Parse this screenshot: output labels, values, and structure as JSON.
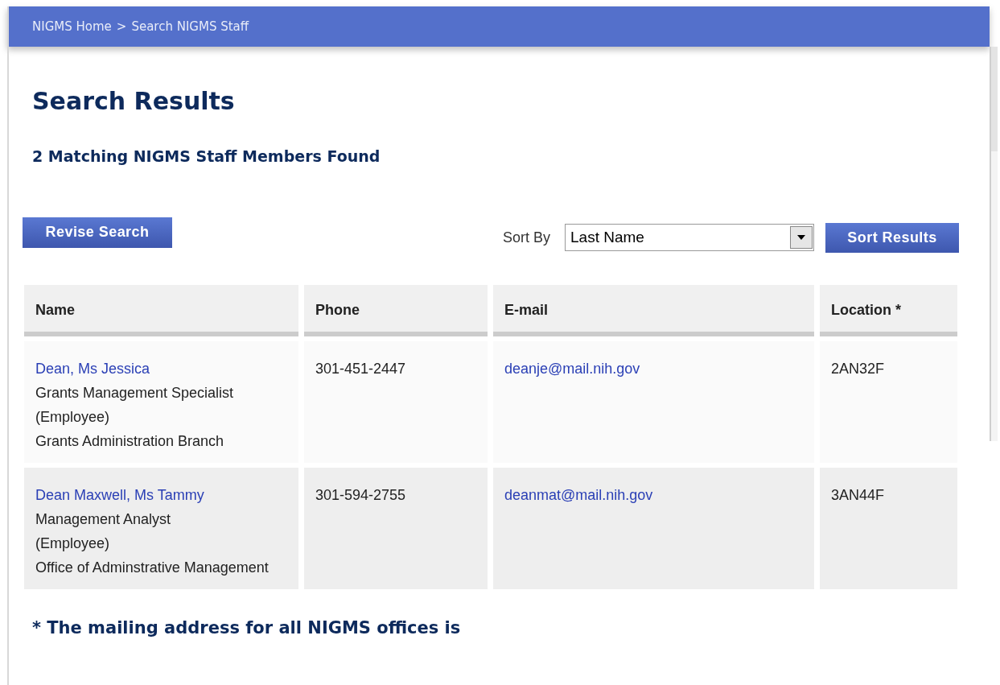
{
  "breadcrumb": [
    "NIGMS Home",
    ">",
    "Search NIGMS Staff"
  ],
  "title": "Search Results",
  "result_count": "2 Matching NIGMS Staff Members Found",
  "revise_button": "Revise Search",
  "sort": {
    "label": "Sort By",
    "value": "Last Name",
    "button": "Sort Results"
  },
  "table": {
    "columns": [
      "Name",
      "Phone",
      "E-mail",
      "Location *"
    ],
    "rows": [
      {
        "name": "Dean, Ms Jessica",
        "details": [
          "Grants Management Specialist",
          "(Employee)",
          "Grants Administration Branch"
        ],
        "phone": "301-451-2447",
        "email": "deanje@mail.nih.gov",
        "location": "2AN32F"
      },
      {
        "name": "Dean Maxwell, Ms Tammy",
        "details": [
          "Management Analyst",
          "(Employee)",
          "Office of Adminstrative Management"
        ],
        "phone": "301-594-2755",
        "email": "deanmat@mail.nih.gov",
        "location": "3AN44F"
      }
    ]
  },
  "footnote": "* The mailing address for all NIGMS offices is"
}
